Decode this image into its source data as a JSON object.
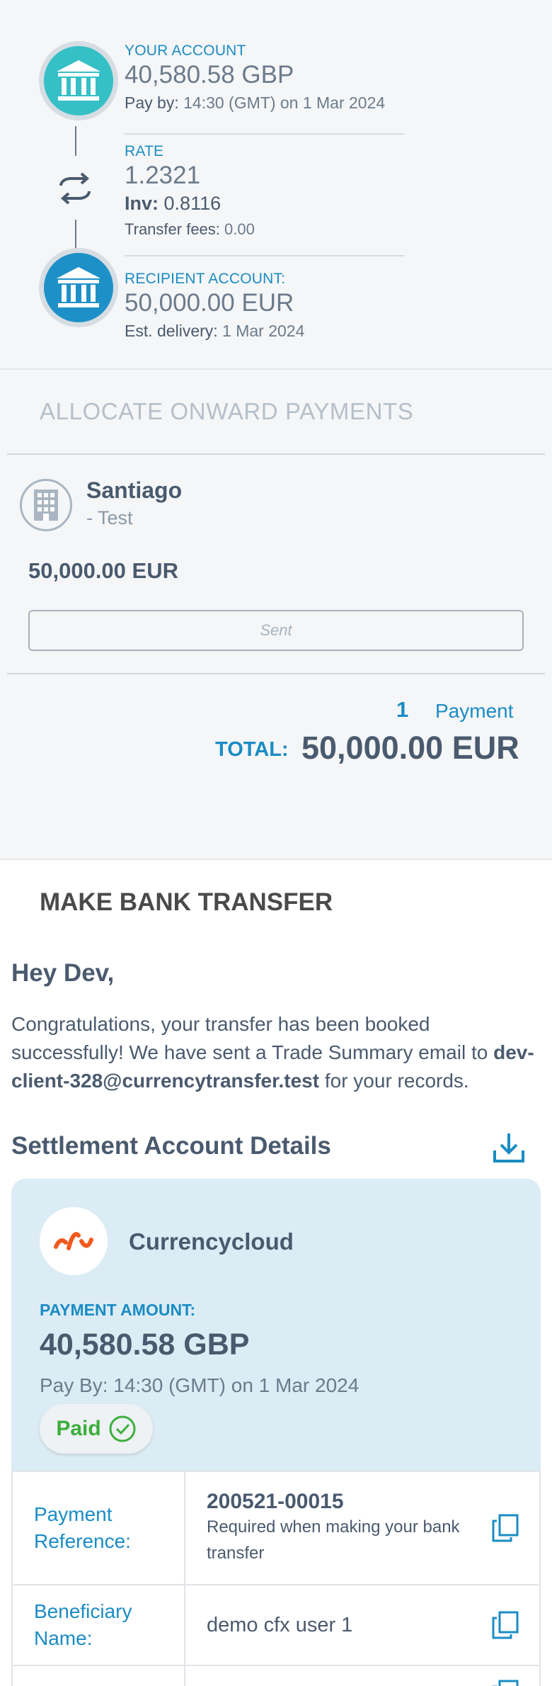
{
  "account": {
    "label": "YOUR ACCOUNT",
    "amount": "40,580.58 GBP",
    "pay_by_label": "Pay by:",
    "pay_by_value": "14:30 (GMT) on 1 Mar 2024"
  },
  "rate": {
    "label": "RATE",
    "value": "1.2321",
    "inv_label": "Inv:",
    "inv_value": "0.8116",
    "fees_label": "Transfer fees:",
    "fees_value": "0.00"
  },
  "recipient": {
    "label": "RECIPIENT ACCOUNT:",
    "amount": "50,000.00 EUR",
    "delivery_label": "Est. delivery:",
    "delivery_value": "1 Mar 2024"
  },
  "allocate_title": "ALLOCATE ONWARD PAYMENTS",
  "payment": {
    "name": "Santiago",
    "sub": "- Test",
    "amount": "50,000.00 EUR",
    "status_button": "Sent"
  },
  "summary": {
    "count": "1",
    "count_label": "Payment",
    "total_label": "TOTAL:",
    "total_value": "50,000.00 EUR"
  },
  "bank_transfer": {
    "title": "MAKE BANK TRANSFER",
    "greeting": "Hey Dev,",
    "message_pre": "Congratulations, your transfer has been booked successfully! We have sent a Trade Summary email to ",
    "email": "dev-client-328@currencytransfer.test",
    "message_post": " for your records.",
    "settlement_title": "Settlement Account Details"
  },
  "settlement_card": {
    "provider": "Currencycloud",
    "payment_amount_label": "PAYMENT AMOUNT:",
    "payment_amount": "40,580.58 GBP",
    "pay_by": "Pay By: 14:30 (GMT) on 1 Mar 2024",
    "paid_label": "Paid"
  },
  "details": {
    "ref_label": "Payment Reference:",
    "ref_value": "200521-00015",
    "ref_note": "Required when making your bank transfer",
    "beneficiary_label": "Beneficiary Name:",
    "beneficiary_value": "demo cfx user 1"
  },
  "colors": {
    "accent_blue": "#1a8cc4",
    "teal_bank": "#35c0c6",
    "blue_bank": "#1e90c8",
    "paid_green": "#3cae3c",
    "logo_orange": "#f05a1e"
  },
  "icons": [
    "bank-icon",
    "swap-icon",
    "building-icon",
    "download-icon",
    "check-circle-icon",
    "copy-icon",
    "currencycloud-logo"
  ]
}
